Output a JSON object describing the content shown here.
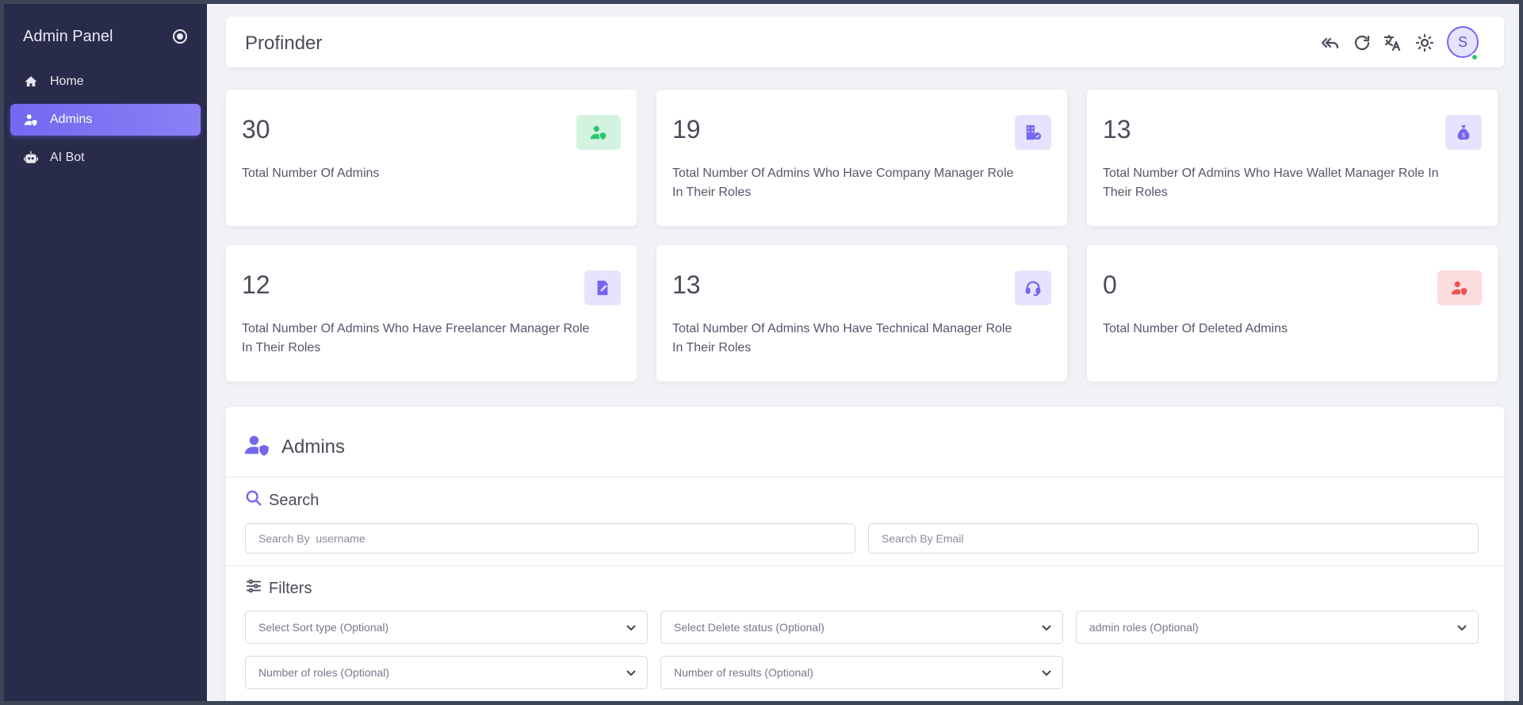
{
  "sidebar": {
    "brand": "Admin Panel",
    "items": [
      {
        "label": "Home",
        "icon": "home-icon"
      },
      {
        "label": "Admins",
        "icon": "user-shield-icon",
        "active": true
      },
      {
        "label": "AI Bot",
        "icon": "robot-icon"
      }
    ]
  },
  "header": {
    "title": "Profinder",
    "avatar_initial": "S",
    "icons": [
      "reply-all-icon",
      "refresh-icon",
      "translate-icon",
      "sun-icon"
    ]
  },
  "stats": [
    {
      "value": "30",
      "label": "Total Number Of Admins",
      "icon": "user-shield-icon",
      "color": "#28c76f",
      "bg": "#d3f3e0"
    },
    {
      "value": "19",
      "label": "Total Number Of Admins Who Have Company Manager Role In Their Roles",
      "icon": "building-icon",
      "color": "#7367f0",
      "bg": "#e5e3fd"
    },
    {
      "value": "13",
      "label": "Total Number Of Admins Who Have Wallet Manager Role In Their Roles",
      "icon": "money-bag-icon",
      "color": "#7367f0",
      "bg": "#e5e3fd"
    },
    {
      "value": "12",
      "label": "Total Number Of Admins Who Have Freelancer Manager Role In Their Roles",
      "icon": "file-pen-icon",
      "color": "#7367f0",
      "bg": "#e5e3fd"
    },
    {
      "value": "13",
      "label": "Total Number Of Admins Who Have Technical Manager Role In Their Roles",
      "icon": "headset-icon",
      "color": "#7367f0",
      "bg": "#e5e3fd"
    },
    {
      "value": "0",
      "label": "Total Number Of Deleted Admins",
      "icon": "user-shield-icon",
      "color": "#ea5455",
      "bg": "#fbdddd"
    }
  ],
  "admins": {
    "title": "Admins",
    "search_title": "Search",
    "search_username_placeholder": "Search By  username",
    "search_email_placeholder": "Search By Email",
    "filters_title": "Filters",
    "filters": [
      "Select Sort type (Optional)",
      "Select Delete status (Optional)",
      "admin roles (Optional)",
      "Number of roles (Optional)",
      "Number of results (Optional)"
    ]
  },
  "colors": {
    "accent": "#7367f0",
    "sidebar_bg": "#292b4a",
    "success": "#28c76f",
    "danger": "#ea5455"
  }
}
